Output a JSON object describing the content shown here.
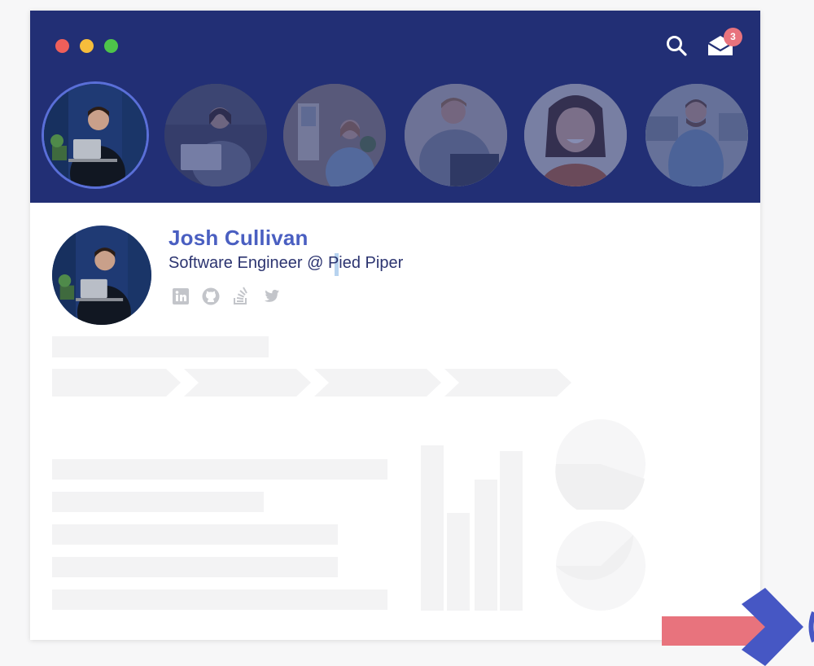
{
  "window": {
    "traffic_lights": [
      "close",
      "minimize",
      "maximize"
    ]
  },
  "toolbar": {
    "search_icon": "search-icon",
    "mail_icon": "mail-icon",
    "unread_count": "3"
  },
  "avatars": [
    {
      "id": "avatar-1",
      "selected": true
    },
    {
      "id": "avatar-2",
      "selected": false
    },
    {
      "id": "avatar-3",
      "selected": false
    },
    {
      "id": "avatar-4",
      "selected": false
    },
    {
      "id": "avatar-5",
      "selected": false
    },
    {
      "id": "avatar-6",
      "selected": false
    }
  ],
  "profile": {
    "name": "Josh Cullivan",
    "title": "Software Engineer @ Pied Piper",
    "social": [
      "linkedin-icon",
      "github-icon",
      "stackoverflow-icon",
      "twitter-icon"
    ]
  },
  "colors": {
    "header": "#222f75",
    "accent": "#4a5fc1",
    "badge": "#e8737d",
    "skeleton": "#f3f3f4",
    "arrow_red": "#e8737d",
    "arrow_blue": "#4657c4"
  }
}
